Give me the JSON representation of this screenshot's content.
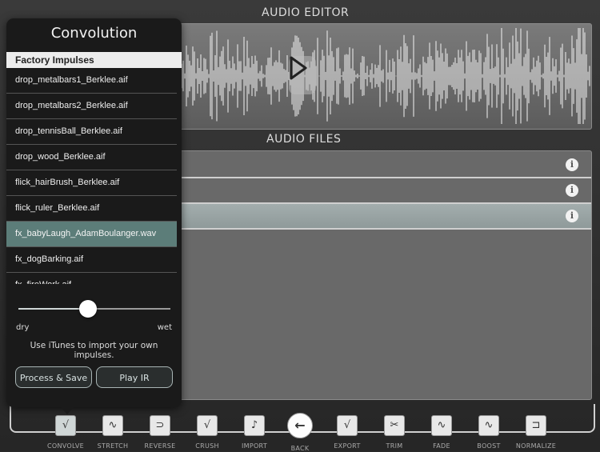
{
  "editor": {
    "title": "AUDIO EDITOR"
  },
  "files": {
    "title": "AUDIO FILES",
    "rows": [
      {
        "selected": false,
        "info_icon": "info-icon"
      },
      {
        "selected": false,
        "info_icon": "info-icon"
      },
      {
        "selected": true,
        "info_icon": "info-icon"
      }
    ]
  },
  "popover": {
    "title": "Convolution",
    "list_header": "Factory Impulses",
    "items": [
      {
        "label": "drop_metalbars1_Berklee.aif",
        "selected": false
      },
      {
        "label": "drop_metalbars2_Berklee.aif",
        "selected": false
      },
      {
        "label": "drop_tennisBall_Berklee.aif",
        "selected": false
      },
      {
        "label": "drop_wood_Berklee.aif",
        "selected": false
      },
      {
        "label": "flick_hairBrush_Berklee.aif",
        "selected": false
      },
      {
        "label": "flick_ruler_Berklee.aif",
        "selected": false
      },
      {
        "label": "fx_babyLaugh_AdamBoulanger.wav",
        "selected": true
      },
      {
        "label": "fx_dogBarking.aif",
        "selected": false
      },
      {
        "label": "fx_fireWork.aif",
        "selected": false
      }
    ],
    "mix": {
      "value": 0.46,
      "min_label": "dry",
      "max_label": "wet"
    },
    "import_note": "Use iTunes to import your own impulses.",
    "process_button": "Process & Save",
    "play_button": "Play IR"
  },
  "toolbar": {
    "tools": [
      {
        "label": "CONVOLVE",
        "icon": "convolve-icon",
        "glyph": "√",
        "active": true
      },
      {
        "label": "STRETCH",
        "icon": "stretch-icon",
        "glyph": "∿"
      },
      {
        "label": "REVERSE",
        "icon": "reverse-icon",
        "glyph": "⊃"
      },
      {
        "label": "CRUSH",
        "icon": "crush-icon",
        "glyph": "√"
      },
      {
        "label": "IMPORT",
        "icon": "music-note-icon",
        "glyph": "♪"
      },
      {
        "label": "BACK",
        "icon": "back-arrow-icon",
        "glyph": "←",
        "back": true
      },
      {
        "label": "EXPORT",
        "icon": "export-icon",
        "glyph": "√"
      },
      {
        "label": "TRIM",
        "icon": "scissors-icon",
        "glyph": "✂"
      },
      {
        "label": "FADE",
        "icon": "fade-icon",
        "glyph": "∿"
      },
      {
        "label": "BOOST",
        "icon": "boost-icon",
        "glyph": "∿"
      },
      {
        "label": "NORMALIZE",
        "icon": "normalize-icon",
        "glyph": "⊐"
      }
    ]
  },
  "colors": {
    "accent_selected": "#5c7d79",
    "panel_bg": "#696969",
    "popover_bg": "#1a1a1a"
  }
}
